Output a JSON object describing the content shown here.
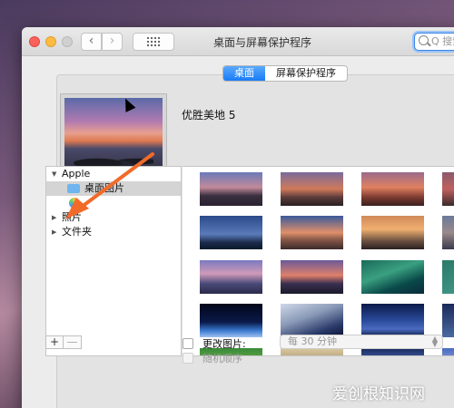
{
  "window": {
    "title": "桌面与屏幕保护程序",
    "search_placeholder": "Q 搜索"
  },
  "tabs": [
    {
      "label": "桌面",
      "active": true
    },
    {
      "label": "屏幕保护程序",
      "active": false
    }
  ],
  "wallpaper": {
    "name": "优胜美地 5"
  },
  "sidebar": {
    "items": [
      {
        "label": "Apple",
        "expanded": true
      },
      {
        "label": "桌面图片",
        "selected": true,
        "icon": "folder-icon"
      },
      {
        "label": "",
        "icon": "photos-icon"
      },
      {
        "label": "照片",
        "expanded": false
      },
      {
        "label": "文件夹",
        "expanded": false
      }
    ]
  },
  "controls": {
    "add_label": "+",
    "remove_label": "—",
    "change_picture_label": "更改图片:",
    "interval_value": "每 30 分钟",
    "random_order_label": "随机顺序"
  },
  "thumbnails": [
    {
      "style": "sierra-dusk"
    },
    {
      "style": "sierra-peak"
    },
    {
      "style": "sierra-red"
    },
    {
      "style": "sierra-edge"
    },
    {
      "style": "yosemite-blue"
    },
    {
      "style": "el-capitan-sunset"
    },
    {
      "style": "half-dome-sunset"
    },
    {
      "style": "mountain-edge"
    },
    {
      "style": "lake-sunset"
    },
    {
      "style": "lake-rocks"
    },
    {
      "style": "wave-green"
    },
    {
      "style": "wave-edge"
    },
    {
      "style": "earth-horizon"
    },
    {
      "style": "earth-orbit"
    },
    {
      "style": "galaxy-sky"
    },
    {
      "style": "space-edge"
    },
    {
      "style": "green-field"
    },
    {
      "style": "desert-dunes"
    },
    {
      "style": "snow-mountain"
    },
    {
      "style": "snow-edge"
    }
  ],
  "watermark": {
    "text_cn": "爱创根知识",
    "text_en": "网"
  }
}
